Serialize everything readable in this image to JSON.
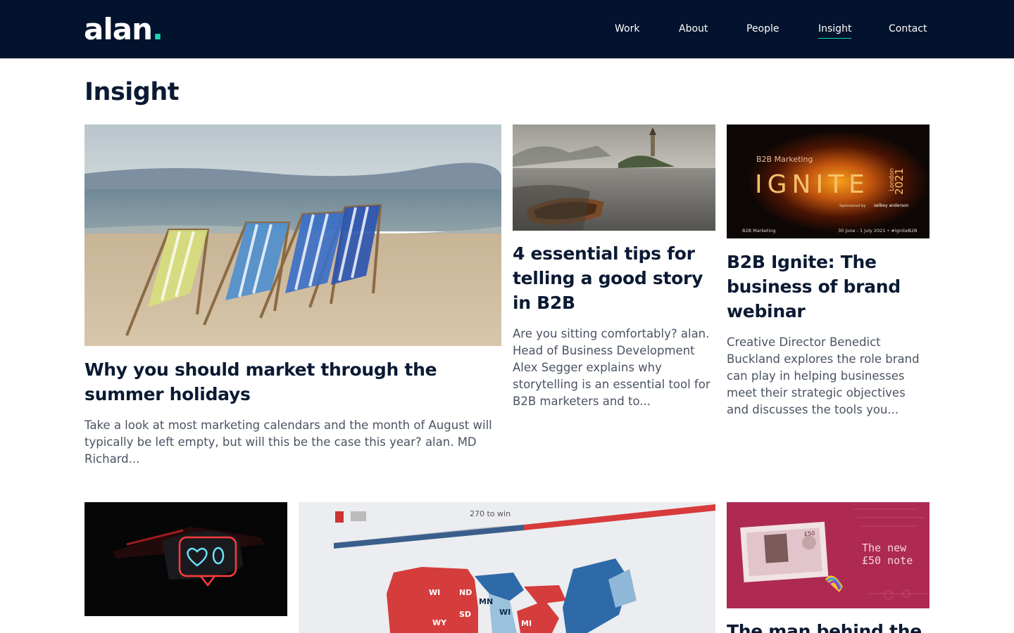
{
  "header": {
    "logo": "alan",
    "logo_dot": ".",
    "nav": [
      {
        "label": "Work"
      },
      {
        "label": "About"
      },
      {
        "label": "People"
      },
      {
        "label": "Insight"
      },
      {
        "label": "Contact"
      }
    ]
  },
  "page": {
    "title": "Insight"
  },
  "articles": [
    {
      "title": "Why you should market through the summer holidays",
      "excerpt": "Take a look at most marketing calendars and the month of August will typically be left empty, but will this be the case this year? alan. MD Richard...",
      "image": "beach-deckchairs-image"
    },
    {
      "title": "4 essential tips for telling a good story in B2B",
      "excerpt": "Are you sitting comfortably? alan. Head of Business Development Alex Segger explains why storytelling is an essential tool for B2B marketers and to...",
      "image": "lake-boat-image"
    },
    {
      "title": "B2B Ignite: The business of brand webinar",
      "excerpt": "Creative Director Benedict Buckland explores the role brand can play in helping businesses meet their strategic objectives and discusses the tools you...",
      "image": "b2b-ignite-banner",
      "image_text": {
        "brand": "B2B Marketing",
        "word": "IGNITE",
        "city": "London",
        "year": "2021",
        "sponsor": "Sponsored by",
        "sponsor_name": "selbey anderson",
        "footer_left": "B2B Marketing",
        "footer_right": "30 June - 1 July 2021 • #IgniteB2B"
      }
    },
    {
      "title": "",
      "excerpt": "",
      "image": "neon-heart-sign-image"
    },
    {
      "title": "",
      "excerpt": "",
      "image": "us-election-map-image",
      "image_text": {
        "headline": "270 to win",
        "states": [
          "WI",
          "ND",
          "MN",
          "SD",
          "WY",
          "WI",
          "MI"
        ]
      }
    },
    {
      "title": "The man behind the",
      "excerpt": "",
      "image": "fifty-pound-note-image",
      "image_text": {
        "caption_line1": "The new",
        "caption_line2": "£50 note",
        "denomination": "£50"
      }
    }
  ],
  "colors": {
    "navy": "#03132d",
    "accent": "#19d6b4",
    "text": "#0b1a33",
    "muted": "#4a5363"
  }
}
